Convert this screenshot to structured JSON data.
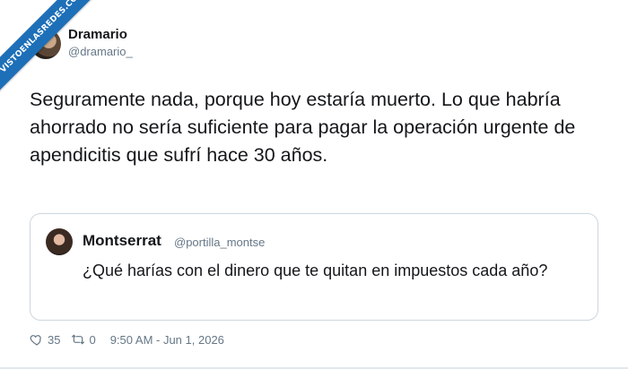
{
  "watermark": {
    "text": "VISTOENLASREDES.COM"
  },
  "tweet": {
    "author": {
      "name": "Dramario",
      "handle": "@dramario_"
    },
    "text": "Seguramente nada, porque hoy estaría muerto. Lo que habría ahorrado no sería suficiente para pagar la operación urgente de apendicitis que sufrí hace 30 años.",
    "quoted": {
      "author": {
        "name": "Montserrat",
        "handle": "@portilla_montse"
      },
      "text": "¿Qué harías con el dinero que te quitan en impuestos cada año?"
    },
    "footer": {
      "likes": "35",
      "retweets": "0",
      "timestamp": "9:50 AM - Jun 1, 2026",
      "like_icon": "heart-icon",
      "retweet_icon": "retweet-icon"
    }
  },
  "colors": {
    "text": "#14171a",
    "secondary": "#657786",
    "border": "#ccd6dd",
    "ribbon": "#1d6fb8"
  }
}
